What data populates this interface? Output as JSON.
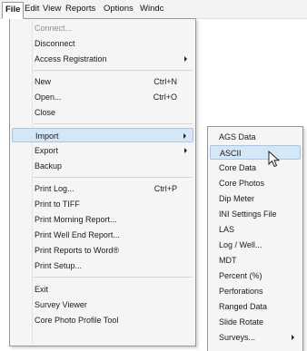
{
  "menubar": {
    "items": [
      "File",
      "Edit",
      "View",
      "Reports",
      "Options",
      "Windc"
    ]
  },
  "file_menu": {
    "items": [
      {
        "label": "Connect...",
        "shortcut": "",
        "disabled": true
      },
      {
        "label": "Disconnect",
        "shortcut": ""
      },
      {
        "label": "Access Registration",
        "shortcut": "",
        "submenu": true
      },
      {
        "label": "New",
        "shortcut": "Ctrl+N"
      },
      {
        "label": "Open...",
        "shortcut": "Ctrl+O"
      },
      {
        "label": "Close",
        "shortcut": ""
      },
      {
        "label": "Import",
        "shortcut": "",
        "submenu": true,
        "highlighted": true
      },
      {
        "label": "Export",
        "shortcut": "",
        "submenu": true
      },
      {
        "label": "Backup",
        "shortcut": ""
      },
      {
        "label": "Print Log...",
        "shortcut": "Ctrl+P"
      },
      {
        "label": "Print to TIFF",
        "shortcut": ""
      },
      {
        "label": "Print Morning Report...",
        "shortcut": ""
      },
      {
        "label": "Print Well End Report...",
        "shortcut": ""
      },
      {
        "label": "Print Reports to Word®",
        "shortcut": ""
      },
      {
        "label": "Print Setup...",
        "shortcut": ""
      },
      {
        "label": "Exit",
        "shortcut": ""
      },
      {
        "label": "Survey Viewer",
        "shortcut": ""
      },
      {
        "label": "Core Photo Profile Tool",
        "shortcut": ""
      }
    ]
  },
  "import_submenu": {
    "items": [
      {
        "label": "AGS Data"
      },
      {
        "label": "ASCII",
        "highlighted": true
      },
      {
        "label": "Core Data"
      },
      {
        "label": "Core Photos"
      },
      {
        "label": "Dip Meter"
      },
      {
        "label": "INI Settings File"
      },
      {
        "label": "LAS"
      },
      {
        "label": "Log / Well..."
      },
      {
        "label": "MDT"
      },
      {
        "label": "Percent (%)"
      },
      {
        "label": "Perforations"
      },
      {
        "label": "Ranged Data"
      },
      {
        "label": "Slide Rotate"
      },
      {
        "label": "Surveys...",
        "submenu": true
      }
    ]
  },
  "colors": {
    "highlight_bg": "#d5e6f7",
    "highlight_border": "#a8c8ea",
    "menu_bg": "#f5f5f5"
  }
}
